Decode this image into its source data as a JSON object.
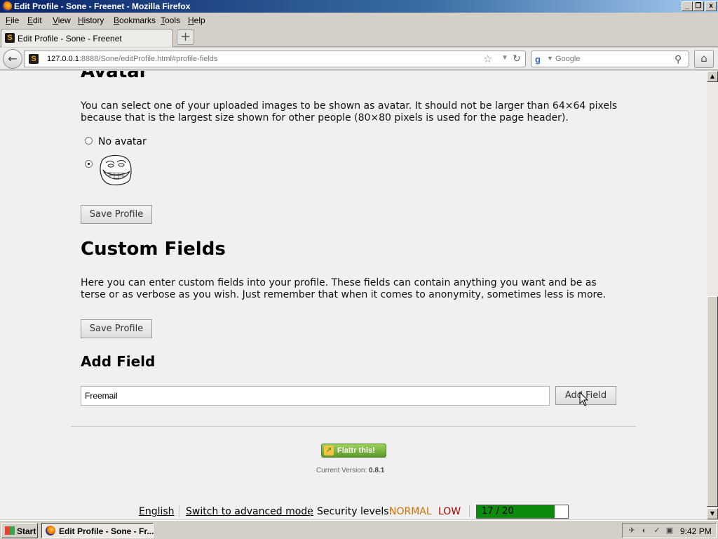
{
  "window": {
    "title": "Edit Profile - Sone - Freenet - Mozilla Firefox",
    "minimize_glyph": "_",
    "restore_glyph": "❐",
    "close_glyph": "x"
  },
  "menu": [
    "File",
    "Edit",
    "View",
    "History",
    "Bookmarks",
    "Tools",
    "Help"
  ],
  "tab": {
    "label": "Edit Profile - Sone - Freenet",
    "favicon": "S",
    "new_tab_glyph": "+"
  },
  "nav": {
    "url_host": "127.0.0.1",
    "url_rest": ":8888/Sone/editProfile.html#profile-fields",
    "search_placeholder": "Google"
  },
  "page": {
    "avatar_heading": "Avatar",
    "avatar_text": "You can select one of your uploaded images to be shown as avatar. It should not be larger than 64×64 pixels because that is the largest size shown for other people (80×80 pixels is used for the page header).",
    "no_avatar_label": "No avatar",
    "save_profile_label": "Save Profile",
    "custom_fields_heading": "Custom Fields",
    "custom_fields_text": "Here you can enter custom fields into your profile. These fields can contain anything you want and be as terse or as verbose as you wish. Just remember that when it comes to anonymity, sometimes less is more.",
    "add_field_heading": "Add Field",
    "add_field_value": "Freemail",
    "add_field_button": "Add Field",
    "flattr_label": "Flattr this!",
    "version_label": "Current Version:",
    "version_value": "0.8.1"
  },
  "statusbar": {
    "language": "English",
    "advanced_mode": "Switch to advanced mode",
    "security_label": "Security levels:",
    "security_network": "NORMAL",
    "security_physical": "LOW",
    "peers_text": "17 / 20",
    "peers_fraction": 0.85
  },
  "taskbar": {
    "start_label": "Start",
    "task_label": "Edit Profile - Sone - Fr...",
    "clock": "9:42 PM"
  },
  "colors": {
    "security_normal": "#d07000",
    "security_low": "#b00000",
    "peers_fill": "#0c8a0c"
  }
}
